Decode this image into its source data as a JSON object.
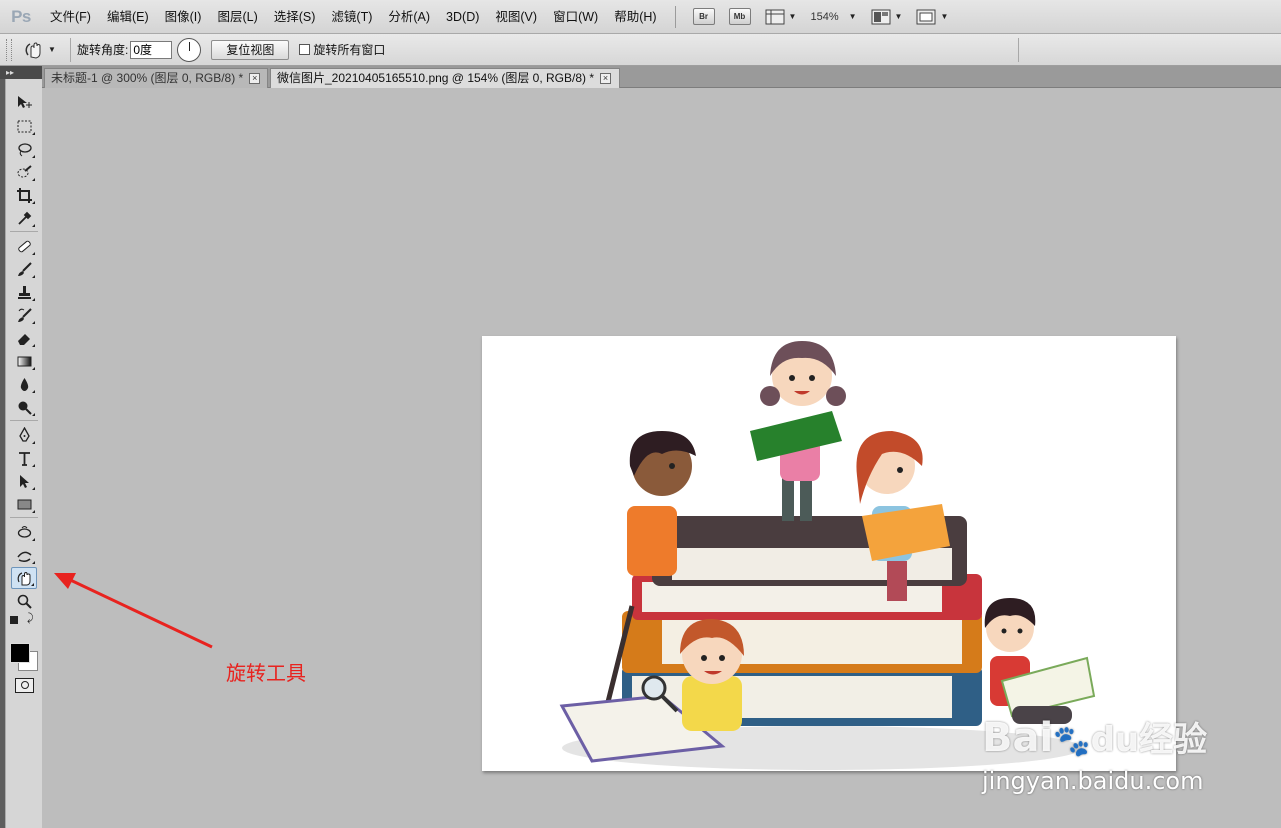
{
  "app": {
    "logo": "Ps"
  },
  "menu": [
    "文件(F)",
    "编辑(E)",
    "图像(I)",
    "图层(L)",
    "选择(S)",
    "滤镜(T)",
    "分析(A)",
    "3D(D)",
    "视图(V)",
    "窗口(W)",
    "帮助(H)"
  ],
  "menubar_tools": {
    "bridge": "Br",
    "minibridge": "Mb",
    "zoom": "154%"
  },
  "options": {
    "rotate_angle_label": "旋转角度:",
    "rotate_angle_value": "0度",
    "reset_view": "复位视图",
    "rotate_all_windows": "旋转所有窗口"
  },
  "tabs": [
    {
      "title": "未标题-1 @ 300% (图层 0, RGB/8) *",
      "close": "×"
    },
    {
      "title": "微信图片_20210405165510.png @ 154% (图层 0, RGB/8) *",
      "close": "×"
    }
  ],
  "annotation": {
    "label": "旋转工具",
    "color": "#e8231f"
  },
  "watermark": {
    "brand": "Bai",
    "brand2": "经验",
    "url": "jingyan.baidu.com"
  },
  "colors": {
    "foreground": "#000000",
    "background": "#ffffff",
    "workspace": "#bdbdbd"
  }
}
